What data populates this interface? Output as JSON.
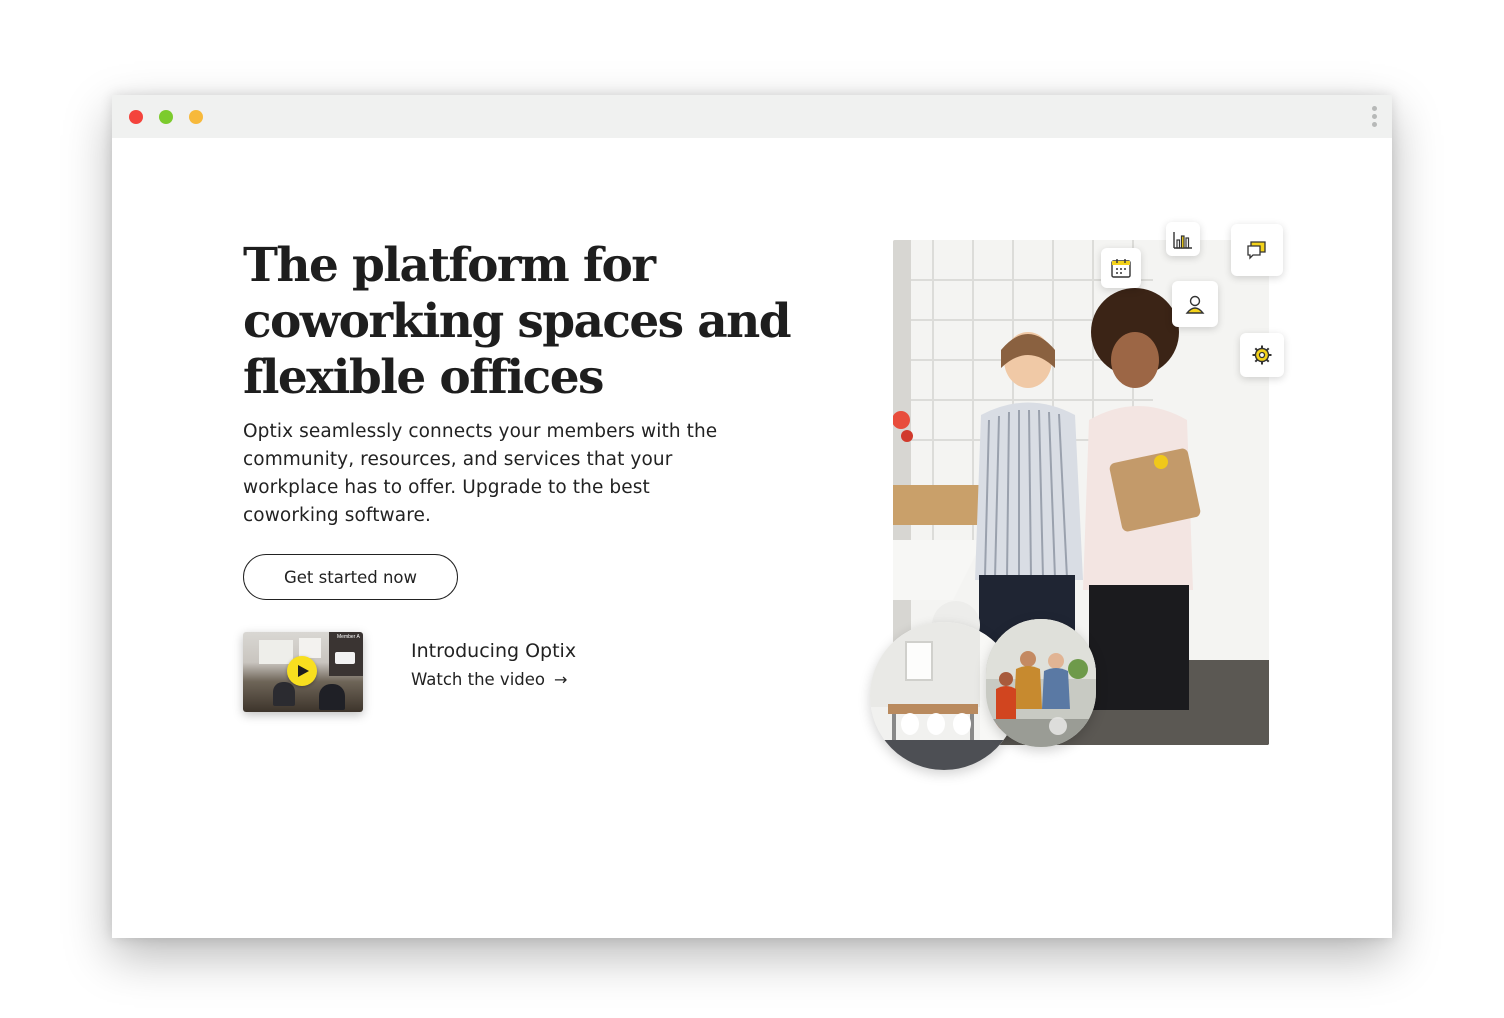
{
  "window": {
    "controls": [
      "close",
      "minimize",
      "maximize"
    ],
    "menu_icon": "kebab-menu-icon"
  },
  "hero": {
    "headline_line1": "The platform for",
    "headline_line2": "coworking spaces and",
    "headline_line3": "flexible offices",
    "lede_line1": "Optix seamlessly connects your members with the",
    "lede_line2": "community, resources, and services that your",
    "lede_line3": "workplace has to offer. Upgrade to the best",
    "lede_line4": "coworking software.",
    "cta_label": "Get started now"
  },
  "video": {
    "title": "Introducing Optix",
    "link_label": "Watch the video",
    "link_arrow": "→",
    "thumb_caption": "Member A",
    "play_icon": "play-icon"
  },
  "floating_icons": [
    "calendar-icon",
    "bar-chart-icon",
    "chat-icon",
    "user-icon",
    "gear-icon"
  ],
  "colors": {
    "accent_yellow": "#f8df1f",
    "text": "#1e1e1e",
    "titlebar": "#f0f1f0",
    "dot_red": "#f4433c",
    "dot_green": "#7ccb2d",
    "dot_yellow": "#f7b93b"
  }
}
